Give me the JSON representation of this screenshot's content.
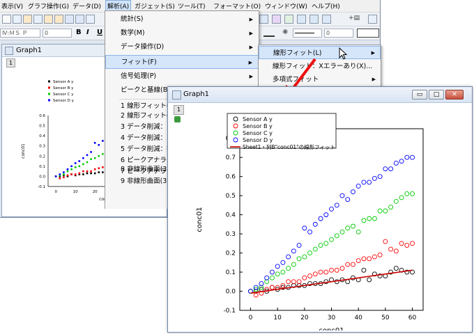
{
  "menubar": {
    "items": [
      "表示(V)",
      "グラフ操作(G)",
      "データ(D)",
      "解析(A)",
      "ガジェット(S)",
      "ツール(T)",
      "フォーマット(O)",
      "ウィンドウ(W)",
      "ヘルプ(H)"
    ],
    "active": "解析(A)"
  },
  "toolbar": {
    "font_combo": "Ⅳ:ＭＳ Ｐ",
    "size_combo": "0",
    "bold": "B",
    "italic": "I",
    "underline": "U",
    "line_combo": "0"
  },
  "bg_graph": {
    "title": "Graph1",
    "layer": "1",
    "xlabel": "conc01",
    "ylabel": "conc01",
    "legend": [
      "Sensor A y",
      "Sensor B y",
      "Sensor C y",
      "Sensor D y"
    ],
    "yticks": [
      "0.6",
      "0.5",
      "0.4",
      "0.3",
      "0.2",
      "0.1",
      "0.0",
      "-0.1"
    ],
    "xticks": [
      "0",
      "10",
      "20"
    ]
  },
  "analysis_menu": {
    "items": [
      {
        "label": "統計(S)",
        "submenu": true
      },
      {
        "label": "数学(M)",
        "submenu": true
      },
      {
        "label": "データ操作(D)",
        "submenu": true
      },
      {
        "label": "フィット(F)",
        "submenu": true,
        "highlighted": true
      },
      {
        "label": "信号処理(P)",
        "submenu": true
      },
      {
        "label": "ピークと基線(B)",
        "submenu": true
      }
    ],
    "recent": [
      "1 線形フィット(L)",
      "2 線形フィット(L)",
      "3 データ削減：ク",
      "4 データ削減：ク",
      "5 データ削減：等",
      "6 ピークアナライ",
      "7 ピークアナライ",
      "8 非線形曲面(3D)",
      "9 非線形曲面(3D)"
    ]
  },
  "fit_submenu": {
    "items": [
      {
        "label": "線形フィット(L)",
        "submenu": true,
        "highlighted": true
      },
      {
        "label": "線形フィット：Xエラーあり(X)...",
        "submenu": false
      },
      {
        "label": "多項式フィット",
        "submenu": true
      }
    ]
  },
  "fg_graph": {
    "title": "Graph1",
    "layer": "1",
    "buttons": {
      "minimize": "▭",
      "maximize": "□",
      "close": "✕"
    }
  },
  "chart_data": {
    "type": "scatter",
    "xlabel": "conc01",
    "ylabel": "conc01",
    "xlim": [
      -4,
      64
    ],
    "ylim": [
      -0.1,
      0.85
    ],
    "xticks": [
      0,
      10,
      20,
      30,
      40,
      50,
      60
    ],
    "yticks": [
      -0.1,
      0.0,
      0.1,
      0.2,
      0.3,
      0.4,
      0.5,
      0.6,
      0.7,
      0.8
    ],
    "grid": false,
    "legend_position": "top-left",
    "series": [
      {
        "name": "Sensor A y",
        "color": "#000000",
        "x": [
          0,
          2,
          4,
          6,
          8,
          10,
          12,
          14,
          16,
          18,
          20,
          22,
          24,
          26,
          28,
          30,
          32,
          34,
          36,
          38,
          40,
          42,
          44,
          46,
          48,
          50,
          52,
          54,
          56,
          58,
          60
        ],
        "y": [
          0.0,
          0.0,
          0.01,
          0.0,
          0.02,
          0.01,
          0.02,
          0.02,
          0.03,
          0.03,
          0.03,
          0.04,
          0.04,
          0.04,
          0.05,
          0.06,
          0.05,
          0.06,
          0.05,
          0.07,
          0.06,
          0.11,
          0.06,
          0.09,
          0.08,
          0.08,
          0.1,
          0.12,
          0.11,
          0.1,
          0.1
        ]
      },
      {
        "name": "Sensor B y",
        "color": "#ff0000",
        "x": [
          0,
          2,
          4,
          6,
          8,
          10,
          12,
          14,
          16,
          18,
          20,
          22,
          24,
          26,
          28,
          30,
          32,
          34,
          36,
          38,
          40,
          42,
          44,
          46,
          48,
          50,
          52,
          54,
          56,
          58,
          60
        ],
        "y": [
          0.0,
          -0.02,
          -0.01,
          0.01,
          0.02,
          0.02,
          0.03,
          0.05,
          0.05,
          0.05,
          0.07,
          0.08,
          0.09,
          0.1,
          0.1,
          0.11,
          0.11,
          0.12,
          0.14,
          0.14,
          0.16,
          0.17,
          0.17,
          0.18,
          0.19,
          0.26,
          0.22,
          0.21,
          0.25,
          0.24,
          0.25
        ]
      },
      {
        "name": "Sensor C y",
        "color": "#00cc00",
        "x": [
          0,
          2,
          4,
          6,
          8,
          10,
          12,
          14,
          16,
          18,
          20,
          22,
          24,
          26,
          28,
          30,
          32,
          34,
          36,
          38,
          40,
          42,
          44,
          46,
          48,
          50,
          52,
          54,
          56,
          58,
          60
        ],
        "y": [
          0.0,
          0.01,
          0.02,
          0.05,
          0.07,
          0.09,
          0.1,
          0.12,
          0.14,
          0.17,
          0.18,
          0.2,
          0.22,
          0.24,
          0.25,
          0.27,
          0.29,
          0.31,
          0.33,
          0.34,
          0.31,
          0.37,
          0.38,
          0.38,
          0.42,
          0.42,
          0.44,
          0.47,
          0.49,
          0.51,
          0.51
        ]
      },
      {
        "name": "Sensor D y",
        "color": "#0000ff",
        "x": [
          0,
          2,
          4,
          6,
          8,
          10,
          12,
          14,
          16,
          18,
          20,
          22,
          24,
          26,
          28,
          30,
          32,
          34,
          36,
          38,
          40,
          42,
          44,
          46,
          48,
          50,
          52,
          54,
          56,
          58,
          60
        ],
        "y": [
          0.0,
          0.02,
          0.04,
          0.07,
          0.1,
          0.13,
          0.15,
          0.18,
          0.21,
          0.24,
          0.33,
          0.31,
          0.35,
          0.38,
          0.4,
          0.43,
          0.45,
          0.5,
          0.48,
          0.52,
          0.55,
          0.57,
          0.57,
          0.59,
          0.6,
          0.64,
          0.64,
          0.67,
          0.68,
          0.7,
          0.7
        ]
      }
    ],
    "fit_line": {
      "name": "Sheet1・列B\"conc01\"の線形フィット",
      "color": "#cc0000",
      "x": [
        0,
        60
      ],
      "y": [
        -0.01,
        0.11
      ]
    }
  }
}
